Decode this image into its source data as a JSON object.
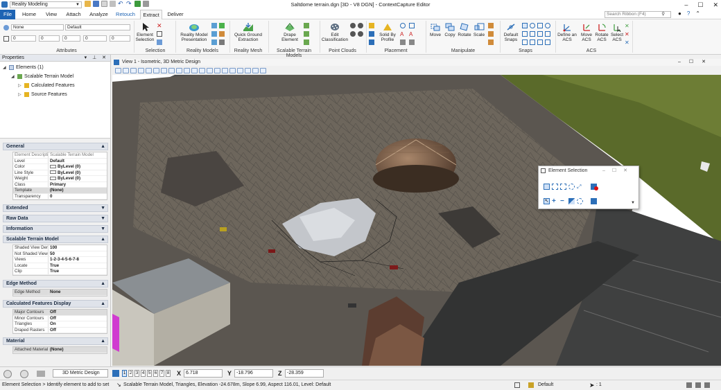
{
  "window": {
    "workspace": "Reality Modeling",
    "title": "Saltdome terrain.dgn [3D - V8 DGN] - ContextCapture Editor",
    "controls": [
      "–",
      "☐",
      "✕"
    ]
  },
  "tabs": [
    {
      "label": "File"
    },
    {
      "label": "Home"
    },
    {
      "label": "View"
    },
    {
      "label": "Attach"
    },
    {
      "label": "Analyze"
    },
    {
      "label": "Retouch"
    },
    {
      "label": "Extract"
    },
    {
      "label": "Deliver"
    }
  ],
  "active_tab": "Extract",
  "ribbon_search": {
    "placeholder": "Search Ribbon (F4)"
  },
  "ribbon": {
    "attributes": {
      "label": "Attributes",
      "level": "None",
      "style": "Default",
      "v1": "0",
      "v2": "0",
      "v3": "0",
      "v4": "0",
      "v5": "0"
    },
    "selection": {
      "label": "Selection",
      "element_selection": "Element Selection"
    },
    "reality_models": {
      "label": "Reality Models",
      "presentation": "Reality Model Presentation"
    },
    "reality_mesh": {
      "label": "Reality Mesh",
      "quick": "Quick Ground Extraction"
    },
    "scalable_terrain": {
      "label": "Scalable Terrain Models",
      "drape": "Drape Element"
    },
    "point_clouds": {
      "label": "Point Clouds",
      "edit": "Edit Classification"
    },
    "placement": {
      "label": "Placement",
      "solid": "Solid By Profile"
    },
    "manipulate": {
      "label": "Manipulate",
      "move": "Move",
      "copy": "Copy",
      "rotate": "Rotate",
      "scale": "Scale"
    },
    "snaps": {
      "label": "Snaps",
      "default": "Default Snaps"
    },
    "acs": {
      "label": "ACS",
      "define": "Define an ACS",
      "move": "Move ACS",
      "rotate": "Rotate ACS",
      "select": "Select ACS"
    }
  },
  "properties": {
    "title": "Properties",
    "tree": [
      {
        "label": "Elements (1)",
        "level": 0
      },
      {
        "label": "Scalable Terrain Model",
        "level": 1
      },
      {
        "label": "Calculated Features",
        "level": 2
      },
      {
        "label": "Source Features",
        "level": 2
      }
    ],
    "sections": {
      "general": "General",
      "extended": "Extended",
      "raw": "Raw Data",
      "information": "Information",
      "stm": "Scalable Terrain Model",
      "edge": "Edge Method",
      "calc": "Calculated Features Display",
      "material": "Material"
    },
    "general_rows": [
      {
        "k": "Element Description",
        "v": "Scalable Terrain Model",
        "style": "grey"
      },
      {
        "k": "Level",
        "v": "Default"
      },
      {
        "k": "Color",
        "v": "ByLevel (0)"
      },
      {
        "k": "Line Style",
        "v": "ByLevel (0)"
      },
      {
        "k": "Weight",
        "v": "ByLevel (0)"
      },
      {
        "k": "Class",
        "v": "Primary"
      },
      {
        "k": "Template",
        "v": "(None)",
        "style": "hl"
      },
      {
        "k": "Transparency",
        "v": "0"
      }
    ],
    "stm_rows": [
      {
        "k": "Shaded View Density",
        "v": "100"
      },
      {
        "k": "Not Shaded View",
        "v": "50"
      },
      {
        "k": "Views",
        "v": "1-2-3-4-5-6-7-8"
      },
      {
        "k": "Locate",
        "v": "True"
      },
      {
        "k": "Clip",
        "v": "True"
      }
    ],
    "edge_rows": [
      {
        "k": "Edge Method",
        "v": "None",
        "style": "hl"
      }
    ],
    "calc_rows": [
      {
        "k": "Major Contours",
        "v": "Off",
        "style": "hl"
      },
      {
        "k": "Minor Contours",
        "v": "Off"
      },
      {
        "k": "Triangles",
        "v": "On"
      },
      {
        "k": "Draped Rasters",
        "v": "Off"
      }
    ],
    "material_rows": [
      {
        "k": "Attached Material",
        "v": "(None)",
        "style": "hl"
      }
    ]
  },
  "view": {
    "title": "View 1 - Isometric, 3D Metric Design"
  },
  "element_selection": {
    "title": "Element Selection"
  },
  "status": {
    "model": "3D Metric Design",
    "views": [
      "1",
      "2",
      "3",
      "4",
      "5",
      "6",
      "7",
      "8"
    ],
    "x_label": "X",
    "x": "6.718",
    "y_label": "Y",
    "y": "-18.796",
    "z_label": "Z",
    "z": "-28.359",
    "prompt": "Element Selection > Identify element to add to set",
    "message": "Scalable Terrain Model, Triangles, Elevation -24.678m, Slope 6.99, Aspect 116.01, Level: Default",
    "level": "Default",
    "count": ": 1"
  }
}
